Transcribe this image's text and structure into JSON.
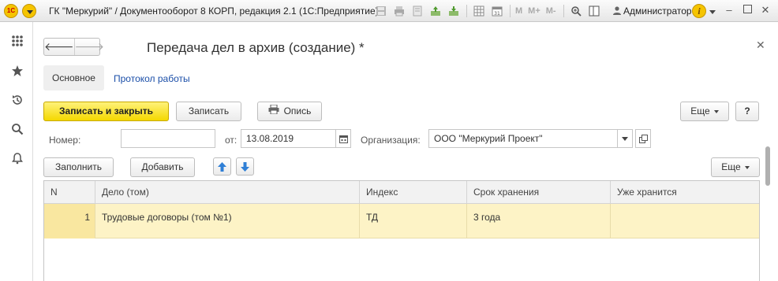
{
  "titlebar": {
    "logo_text": "1С",
    "title": "ГК \"Меркурий\" / Документооборот 8 КОРП, редакция 2.1  (1С:Предприятие)",
    "tools": [
      "save-icon",
      "print-icon",
      "preview-icon",
      "attach-icon",
      "upload-icon",
      "table-icon",
      "calendar-icon"
    ],
    "m_buttons": [
      "M",
      "M+",
      "M-"
    ],
    "user": "Администратор",
    "info_glyph": "i"
  },
  "leftbar": {
    "icons": [
      "apps-grid-icon",
      "favorites-star-icon",
      "history-icon",
      "search-icon",
      "notifications-bell-icon"
    ]
  },
  "form": {
    "title": "Передача дел в архив (создание) *",
    "tabs": {
      "main": "Основное",
      "log": "Протокол работы"
    },
    "toolbar": {
      "save_close": "Записать и закрыть",
      "save": "Записать",
      "inventory": "Опись",
      "more": "Еще",
      "help": "?"
    },
    "fields": {
      "number_label": "Номер:",
      "number_value": "",
      "date_label": "от:",
      "date_value": "13.08.2019",
      "org_label": "Организация:",
      "org_value": "ООО \"Меркурий Проект\""
    },
    "table_toolbar": {
      "fill": "Заполнить",
      "add": "Добавить",
      "more": "Еще"
    },
    "table": {
      "columns": [
        "N",
        "Дело (том)",
        "Индекс",
        "Срок хранения",
        "Уже хранится"
      ],
      "rows": [
        {
          "n": "1",
          "case": "Трудовые договоры (том №1)",
          "index": "ТД",
          "period": "3 года",
          "stored": ""
        }
      ]
    }
  },
  "colors": {
    "accent_yellow": "#f4d800",
    "link_blue": "#1a4ea8",
    "row_highlight": "#fdf3c6",
    "arrow_blue": "#2f7fd6"
  }
}
